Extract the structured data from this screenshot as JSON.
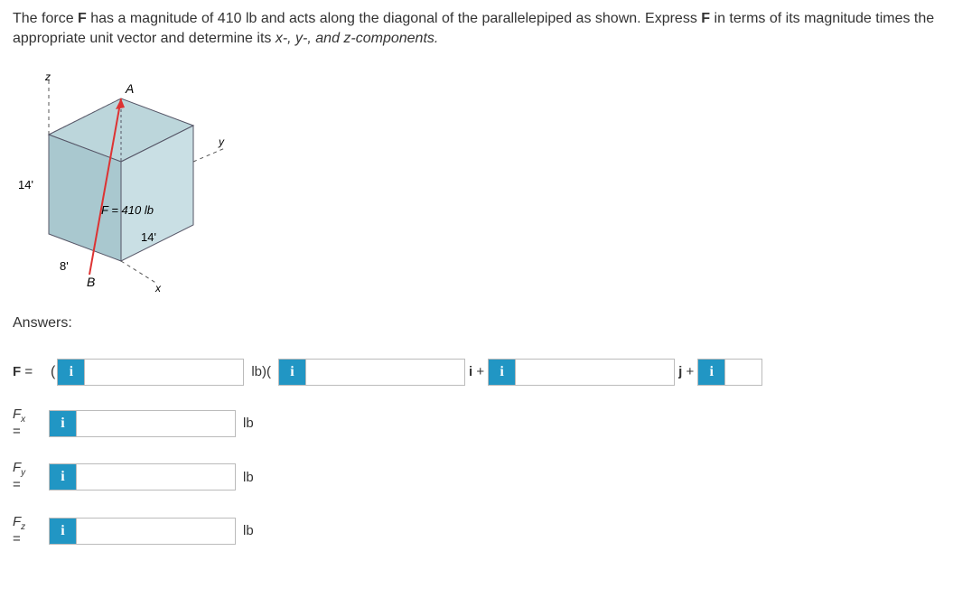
{
  "problem": {
    "text_before_F1": "The force ",
    "F": "F",
    "text_mid1": " has a magnitude of 410 lb and acts along the diagonal of the parallelepiped as shown. Express ",
    "text_mid2": " in terms of its magnitude times the appropriate unit vector and determine its ",
    "xyz": "x-, y-, and z-components."
  },
  "figure": {
    "z_label": "z",
    "A_label": "A",
    "y_label": "y",
    "x_label": "x",
    "B_label": "B",
    "dim_14v": "14'",
    "dim_14h": "14'",
    "dim_8": "8'",
    "force_label": "F = 410 lb"
  },
  "answers_heading": "Answers:",
  "row1": {
    "label": "F",
    "equals": "=",
    "open": "(",
    "mid1": "lb)(",
    "vec_i": "i",
    "plus1": "+",
    "vec_j": "j",
    "plus2": "+"
  },
  "row_fx": {
    "sym": "F",
    "sub": "x",
    "equals": "=",
    "unit": "lb"
  },
  "row_fy": {
    "sym": "F",
    "sub": "y",
    "equals": "=",
    "unit": "lb"
  },
  "row_fz": {
    "sym": "F",
    "sub": "z",
    "equals": "=",
    "unit": "lb"
  },
  "info_icon": "i"
}
